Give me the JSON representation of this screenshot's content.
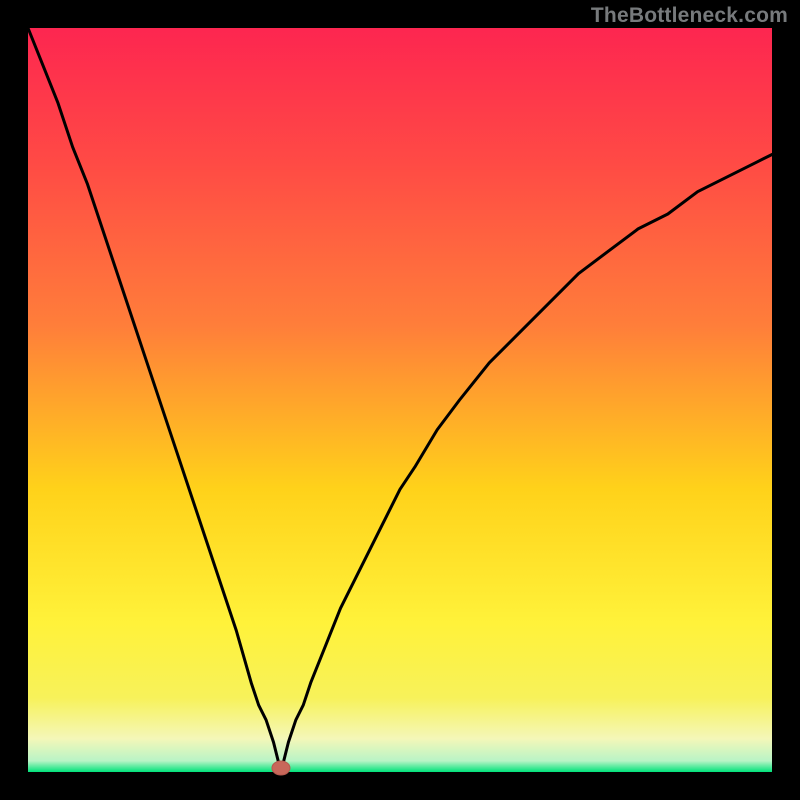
{
  "watermark": "TheBottleneck.com",
  "colors": {
    "frame": "#000000",
    "curve": "#000000",
    "marker_fill": "#c8675a",
    "marker_stroke": "#b65a4e",
    "gradient_top": "#fd2650",
    "gradient_mid1": "#ff7e3a",
    "gradient_mid2": "#ffd21a",
    "gradient_mid3": "#f7f25a",
    "gradient_mid4": "#f4f7b8",
    "gradient_bottom": "#00e27a"
  },
  "chart_data": {
    "type": "line",
    "title": "",
    "xlabel": "",
    "ylabel": "",
    "xlim": [
      0,
      100
    ],
    "ylim": [
      0,
      100
    ],
    "marker": {
      "x": 34,
      "y": 0
    },
    "series": [
      {
        "name": "bottleneck-curve",
        "x": [
          0,
          2,
          4,
          6,
          8,
          10,
          12,
          14,
          16,
          18,
          20,
          22,
          24,
          26,
          28,
          30,
          31,
          32,
          33,
          34,
          35,
          36,
          37,
          38,
          40,
          42,
          44,
          46,
          48,
          50,
          52,
          55,
          58,
          62,
          66,
          70,
          74,
          78,
          82,
          86,
          90,
          94,
          98,
          100
        ],
        "y": [
          100,
          95,
          90,
          84,
          79,
          73,
          67,
          61,
          55,
          49,
          43,
          37,
          31,
          25,
          19,
          12,
          9,
          7,
          4,
          0,
          4,
          7,
          9,
          12,
          17,
          22,
          26,
          30,
          34,
          38,
          41,
          46,
          50,
          55,
          59,
          63,
          67,
          70,
          73,
          75,
          78,
          80,
          82,
          83
        ]
      }
    ]
  }
}
